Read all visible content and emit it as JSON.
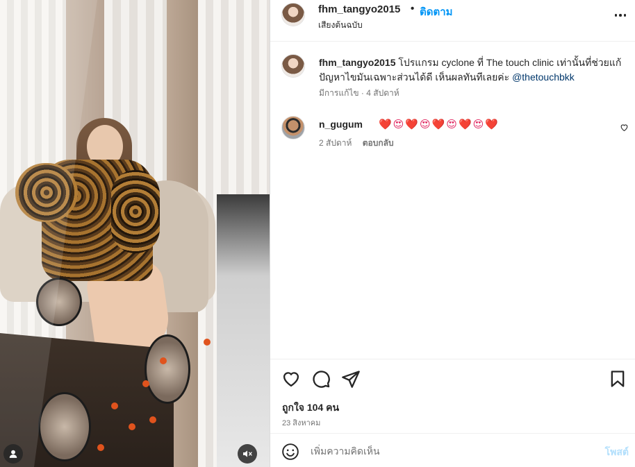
{
  "post": {
    "username": "fhm_tangyo2015",
    "follow_label": "ติดตาม",
    "separator": "•",
    "audio_label": "เสียงต้นฉบับ"
  },
  "caption": {
    "username": "fhm_tangyo2015",
    "text": "โปรแกรม cyclone ที่ The touch clinic เท่านั้นที่ช่วยแก้ปัญหาไขมันเฉพาะส่วนได้ดี เห็นผลทันทีเลยค่ะ",
    "mention": "@thetouchbkk",
    "meta": "มีการแก้ไข · 4 สัปดาห์"
  },
  "comments": [
    {
      "username": "n_gugum",
      "text": "❤️😍❤️😍❤️😍❤️😍❤️",
      "time": "2 สัปดาห์",
      "reply_label": "ตอบกลับ"
    }
  ],
  "actions": {
    "likes": "ถูกใจ 104 คน",
    "date": "23 สิงหาคม"
  },
  "composer": {
    "placeholder": "เพิ่มความคิดเห็น",
    "post_label": "โพสต์"
  },
  "icons": {
    "more": "more-horizontal-icon",
    "like": "heart-outline-icon",
    "comment": "comment-bubble-icon",
    "share": "paper-plane-icon",
    "save": "bookmark-outline-icon",
    "emoji": "smiley-icon",
    "tagged_users": "user-tag-icon",
    "mute": "speaker-muted-icon"
  },
  "colors": {
    "follow": "#0095f6",
    "mention": "#00376b",
    "post_disabled": "#b2dffc",
    "secondary_text": "#737373"
  }
}
